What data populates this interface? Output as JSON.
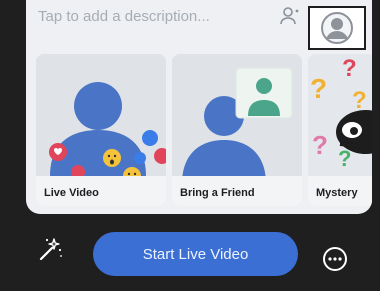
{
  "description": {
    "placeholder": "Tap to add a description..."
  },
  "icons": {
    "tag": "tag-people-icon",
    "avatar": "profile-avatar-icon",
    "effects": "magic-wand-icon",
    "more": "more-options-icon"
  },
  "cards": [
    {
      "label": "Live Video"
    },
    {
      "label": "Bring a Friend"
    },
    {
      "label": "Mystery"
    }
  ],
  "actions": {
    "start_label": "Start Live Video"
  },
  "colors": {
    "primary": "#3b6fd4",
    "sheet": "#eef0f3",
    "dark": "#1f1f1f",
    "silhouette": "#4a74c6",
    "friend": "#4aa58a"
  }
}
